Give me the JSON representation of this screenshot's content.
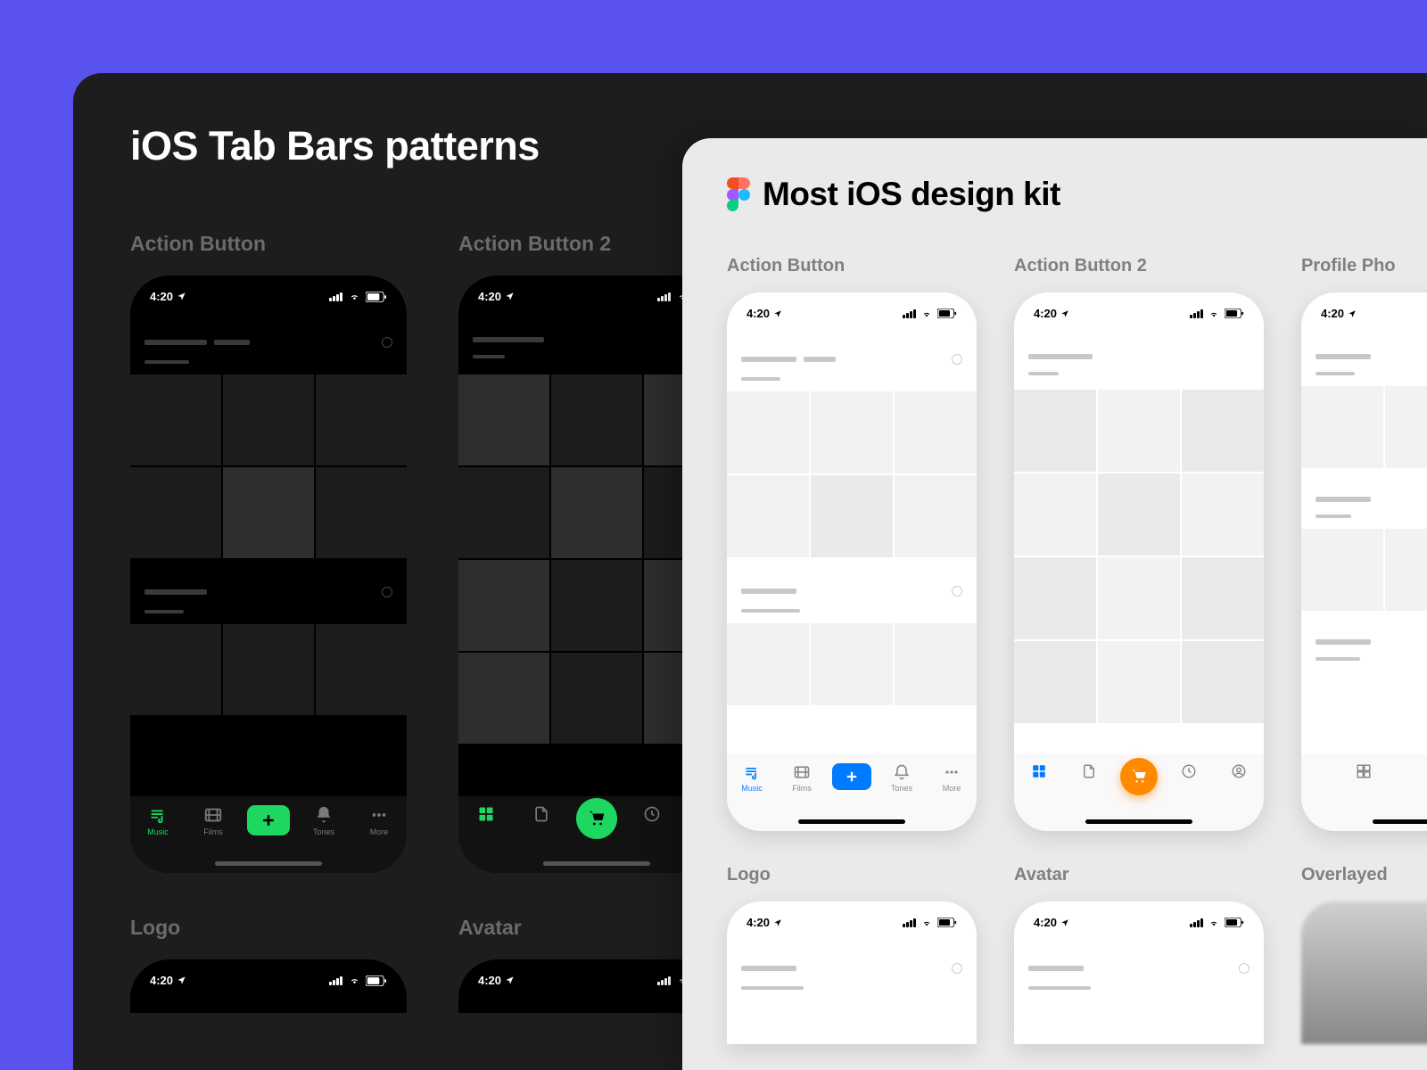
{
  "colors": {
    "accent_green": "#1ED760",
    "accent_blue": "#007AFF",
    "accent_orange": "#FF8A00",
    "bg_purple": "#5A52EE"
  },
  "dark_panel": {
    "title": "iOS Tab Bars patterns",
    "sections": {
      "action_button": {
        "label": "Action Button"
      },
      "action_button_2": {
        "label": "Action Button 2"
      },
      "logo": {
        "label": "Logo"
      },
      "avatar": {
        "label": "Avatar"
      }
    }
  },
  "light_panel": {
    "title": "Most iOS design kit",
    "sections": {
      "action_button": {
        "label": "Action Button"
      },
      "action_button_2": {
        "label": "Action Button 2"
      },
      "profile_photo": {
        "label": "Profile Pho"
      },
      "logo": {
        "label": "Logo"
      },
      "avatar": {
        "label": "Avatar"
      },
      "overlayed": {
        "label": "Overlayed"
      }
    }
  },
  "status_bar": {
    "time": "4:20"
  },
  "tabs": {
    "music": "Music",
    "films": "Films",
    "tones": "Tones",
    "more": "More"
  }
}
